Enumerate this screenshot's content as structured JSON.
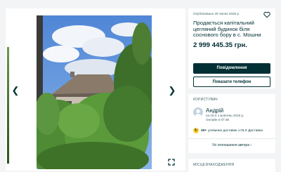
{
  "listing": {
    "posted": "Опубліковано 29 липня 2026 р.",
    "title": "Продається капітальний цегляний будинок біля соснового бору в с. Мошни",
    "price": "2 999 445.35 грн.",
    "message_button": "Повідомлення",
    "phone_button": "Показати телефон"
  },
  "seller": {
    "section_title": "КОРИСТУВАЧ",
    "name": "Андрій",
    "since": "на OLX з жовтень 2016 р.",
    "online": "Онлайн в 07:38",
    "deliveries_count": "20+",
    "deliveries_text": "успішних доставок з OLX Доставка",
    "all_ads_label": "Усі оголошення автора"
  },
  "location": {
    "section_title": "МІСЦЕЗНАХОДЖЕННЯ"
  },
  "icons": {
    "prev": "chevron-left-icon",
    "next": "chevron-right-icon",
    "fullscreen": "expand-icon",
    "favorite": "heart-icon"
  },
  "colors": {
    "primary": "#002f34",
    "background": "#f2f4f5",
    "delivery_badge": "#ffce32"
  }
}
